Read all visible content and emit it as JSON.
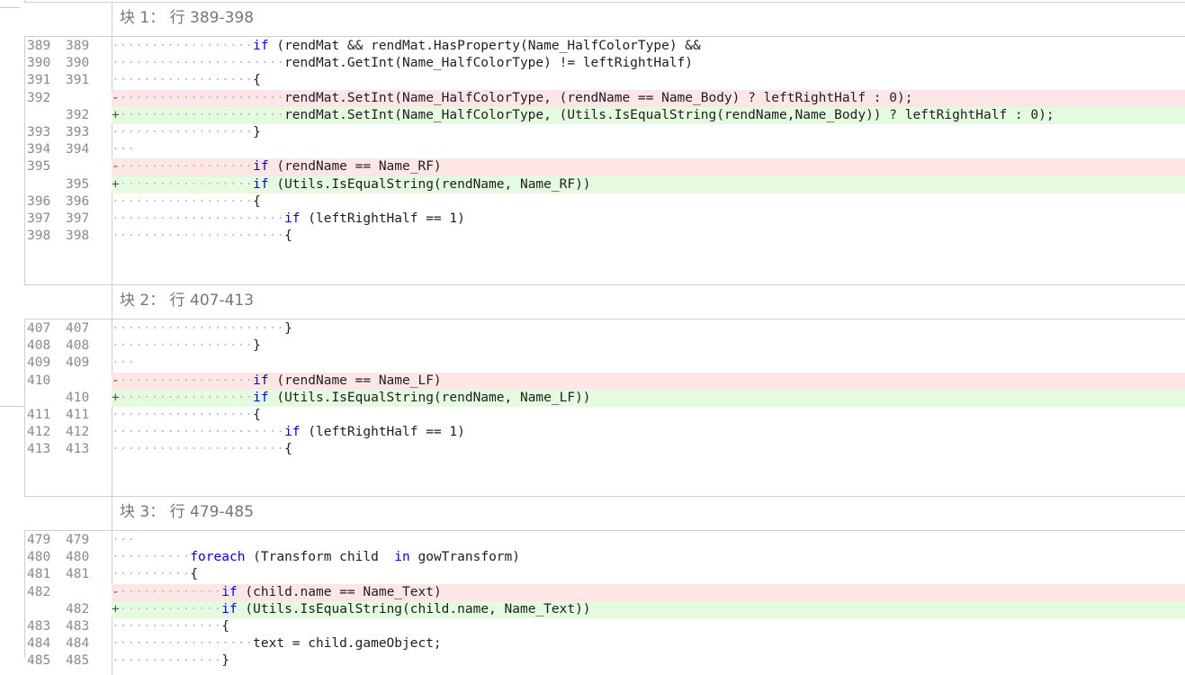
{
  "hunks": [
    {
      "title": "块 1： 行 389-398",
      "lines": [
        {
          "type": "ctx",
          "old": "389",
          "new": "389",
          "indent": "··················",
          "text": "if (rendMat && rendMat.HasProperty(Name_HalfColorType) &&"
        },
        {
          "type": "ctx",
          "old": "390",
          "new": "390",
          "indent": "······················",
          "text": "rendMat.GetInt(Name_HalfColorType) != leftRightHalf)"
        },
        {
          "type": "ctx",
          "old": "391",
          "new": "391",
          "indent": "··················",
          "text": "{"
        },
        {
          "type": "del",
          "old": "392",
          "new": "",
          "indent": "-·····················",
          "text": "rendMat.SetInt(Name_HalfColorType, (rendName == Name_Body) ? leftRightHalf : 0);"
        },
        {
          "type": "add",
          "old": "",
          "new": "392",
          "indent": "+·····················",
          "text": "rendMat.SetInt(Name_HalfColorType, (Utils.IsEqualString(rendName,Name_Body)) ? leftRightHalf : 0);"
        },
        {
          "type": "ctx",
          "old": "393",
          "new": "393",
          "indent": "··················",
          "text": "}"
        },
        {
          "type": "ctx",
          "old": "394",
          "new": "394",
          "indent": "···",
          "text": ""
        },
        {
          "type": "del",
          "old": "395",
          "new": "",
          "indent": "-·················",
          "text": "if (rendName == Name_RF)"
        },
        {
          "type": "add",
          "old": "",
          "new": "395",
          "indent": "+·················",
          "text": "if (Utils.IsEqualString(rendName, Name_RF))"
        },
        {
          "type": "ctx",
          "old": "396",
          "new": "396",
          "indent": "··················",
          "text": "{"
        },
        {
          "type": "ctx",
          "old": "397",
          "new": "397",
          "indent": "······················",
          "text": "if (leftRightHalf == 1)"
        },
        {
          "type": "ctx",
          "old": "398",
          "new": "398",
          "indent": "······················",
          "text": "{"
        }
      ]
    },
    {
      "title": "块 2： 行 407-413",
      "lines": [
        {
          "type": "ctx",
          "old": "407",
          "new": "407",
          "indent": "······················",
          "text": "}"
        },
        {
          "type": "ctx",
          "old": "408",
          "new": "408",
          "indent": "··················",
          "text": "}"
        },
        {
          "type": "ctx",
          "old": "409",
          "new": "409",
          "indent": "···",
          "text": ""
        },
        {
          "type": "del",
          "old": "410",
          "new": "",
          "indent": "-·················",
          "text": "if (rendName == Name_LF)"
        },
        {
          "type": "add",
          "old": "",
          "new": "410",
          "indent": "+·················",
          "text": "if (Utils.IsEqualString(rendName, Name_LF))"
        },
        {
          "type": "ctx",
          "old": "411",
          "new": "411",
          "indent": "··················",
          "text": "{"
        },
        {
          "type": "ctx",
          "old": "412",
          "new": "412",
          "indent": "······················",
          "text": "if (leftRightHalf == 1)"
        },
        {
          "type": "ctx",
          "old": "413",
          "new": "413",
          "indent": "······················",
          "text": "{"
        }
      ]
    },
    {
      "title": "块 3： 行 479-485",
      "lines": [
        {
          "type": "ctx",
          "old": "479",
          "new": "479",
          "indent": "···",
          "text": ""
        },
        {
          "type": "ctx",
          "old": "480",
          "new": "480",
          "indent": "··········",
          "text": "foreach (Transform child  in gowTransform)"
        },
        {
          "type": "ctx",
          "old": "481",
          "new": "481",
          "indent": "··········",
          "text": "{"
        },
        {
          "type": "del",
          "old": "482",
          "new": "",
          "indent": "-·············",
          "text": "if (child.name == Name_Text)"
        },
        {
          "type": "add",
          "old": "",
          "new": "482",
          "indent": "+·············",
          "text": "if (Utils.IsEqualString(child.name, Name_Text))"
        },
        {
          "type": "ctx",
          "old": "483",
          "new": "483",
          "indent": "··············",
          "text": "{"
        },
        {
          "type": "ctx",
          "old": "484",
          "new": "484",
          "indent": "··················",
          "text": "text = child.gameObject;"
        },
        {
          "type": "ctx",
          "old": "485",
          "new": "485",
          "indent": "··············",
          "text": "}"
        }
      ]
    }
  ],
  "keywords": [
    "if",
    "foreach",
    "in"
  ]
}
